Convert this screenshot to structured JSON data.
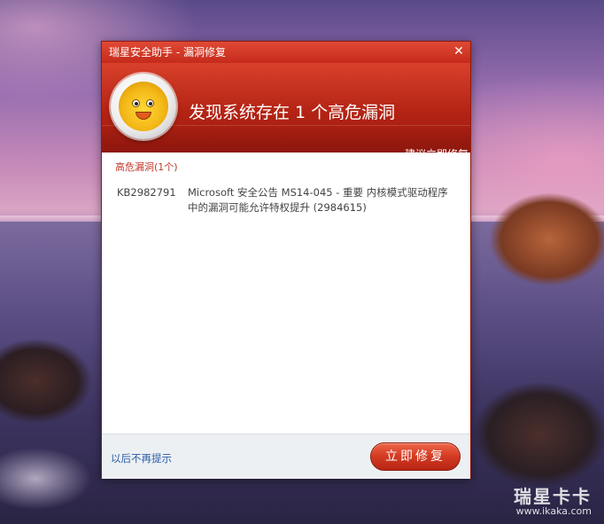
{
  "window": {
    "title": "瑞星安全助手 - 漏洞修复",
    "close_glyph": "✕"
  },
  "banner": {
    "headline": "发现系统存在 1 个高危漏洞",
    "subline": "建议立即修复",
    "mascot_icon": "lion-mascot-icon"
  },
  "content": {
    "section_label": "高危漏洞(1个)",
    "vulnerabilities": [
      {
        "id": "KB2982791",
        "description": "Microsoft 安全公告 MS14-045 - 重要 内核模式驱动程序中的漏洞可能允许特权提升 (2984615)"
      }
    ]
  },
  "footer": {
    "dont_remind_label": "以后不再提示",
    "fix_now_label": "立即修复"
  },
  "desktop": {
    "watermark_name": "瑞星卡卡",
    "watermark_url": "www.ikaka.com"
  },
  "colors": {
    "accent": "#c52a1b",
    "link": "#2a5da8",
    "section_label": "#c0392b"
  }
}
